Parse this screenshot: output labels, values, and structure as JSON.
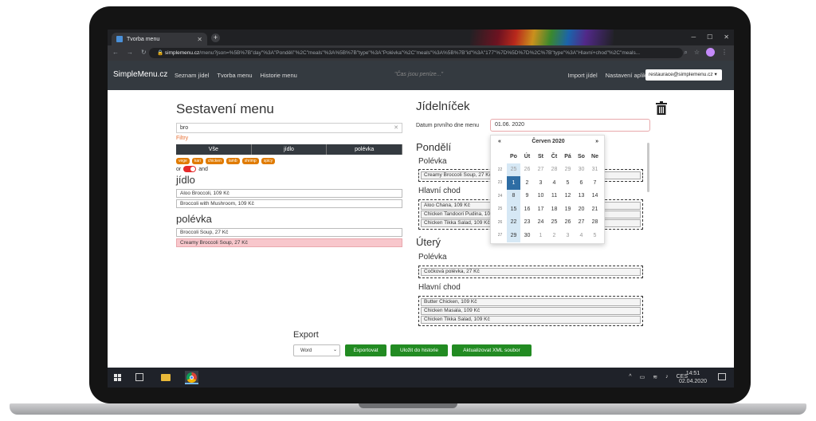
{
  "browser": {
    "tab_title": "Tvorba menu",
    "url_domain": "simplemenu.cz",
    "url_rest": "/menu?json=%5B%7B\"day\"%3A\"Pondělí\"%2C\"meals\"%3A%5B%7B\"type\"%3A\"Polévka\"%2C\"meals\"%3A%5B%7B\"id\"%3A\"177\"%7D%5D%7D%2C%7B\"type\"%3A\"Hlavní+chod\"%2C\"meals..."
  },
  "navbar": {
    "brand": "SimpleMenu.cz",
    "links": [
      "Seznam jídel",
      "Tvorba menu",
      "Historie menu"
    ],
    "motto": "\"Čas jsou peníze...\"",
    "import": "Import jídel",
    "settings": "Nastavení aplikace",
    "user": "restaurace@simplemenu.cz ▾"
  },
  "left": {
    "title": "Sestavení menu",
    "search_value": "bro",
    "filters_label": "Filtry",
    "segments": [
      "Vše",
      "jídlo",
      "polévka"
    ],
    "tags": [
      "vege",
      "kari",
      "chicken",
      "lamb",
      "shrimp",
      "spicy"
    ],
    "or_label": "or",
    "and_label": "and",
    "section_jidlo": "jídlo",
    "jidlo_items": [
      "Aloo Broccoli, 109 Kč",
      "Broccoli with Mushroom, 109 Kč"
    ],
    "section_polevka": "polévka",
    "polevka_items": [
      "Broccoli Soup, 27 Kč",
      "Creamy Broccoli Soup, 27 Kč"
    ]
  },
  "right": {
    "title": "Jídelníček",
    "date_label": "Datum prvního dne menu",
    "date_value": "01.06. 2020",
    "days": [
      {
        "name": "Pondělí",
        "polevka_label": "Polévka",
        "polevka": [
          "Creamy Broccoli Soup, 27 Kč"
        ],
        "hlavni_label": "Hlavní chod",
        "hlavni": [
          "Aloo Chana, 109 Kč",
          "Chicken Tandoori Pudina, 109 Kč",
          "Chicken Tikka Salad, 109 Kč"
        ]
      },
      {
        "name": "Úterý",
        "polevka_label": "Polévka",
        "polevka": [
          "Čočková polévka, 27 Kč"
        ],
        "hlavni_label": "Hlavní chod",
        "hlavni": [
          "Butter Chicken, 109 Kč",
          "Chicken Masala, 109 Kč",
          "Chicken Tikka Salad, 109 Kč"
        ]
      }
    ]
  },
  "datepicker": {
    "prev": "«",
    "next": "»",
    "month": "Červen 2020",
    "weekdays": [
      "Po",
      "Út",
      "St",
      "Čt",
      "Pá",
      "So",
      "Ne"
    ],
    "weeks": [
      {
        "wk": "22",
        "days": [
          "25",
          "26",
          "27",
          "28",
          "29",
          "30",
          "31"
        ]
      },
      {
        "wk": "23",
        "days": [
          "1",
          "2",
          "3",
          "4",
          "5",
          "6",
          "7"
        ]
      },
      {
        "wk": "24",
        "days": [
          "8",
          "9",
          "10",
          "11",
          "12",
          "13",
          "14"
        ]
      },
      {
        "wk": "25",
        "days": [
          "15",
          "16",
          "17",
          "18",
          "19",
          "20",
          "21"
        ]
      },
      {
        "wk": "26",
        "days": [
          "22",
          "23",
          "24",
          "25",
          "26",
          "27",
          "28"
        ]
      },
      {
        "wk": "27",
        "days": [
          "29",
          "30",
          "1",
          "2",
          "3",
          "4",
          "5"
        ]
      }
    ]
  },
  "export": {
    "title": "Export",
    "format": "Word",
    "btn_export": "Exportovat",
    "btn_save": "Uložit do historie",
    "btn_xml": "Aktualizovat XML soubor"
  },
  "taskbar": {
    "lang": "CES",
    "time": "14:51",
    "date": "02.04.2020"
  },
  "colors": {
    "accent_green": "#228b22",
    "selected_pink": "#f8c7cc",
    "today_blue": "#2e6da4"
  }
}
